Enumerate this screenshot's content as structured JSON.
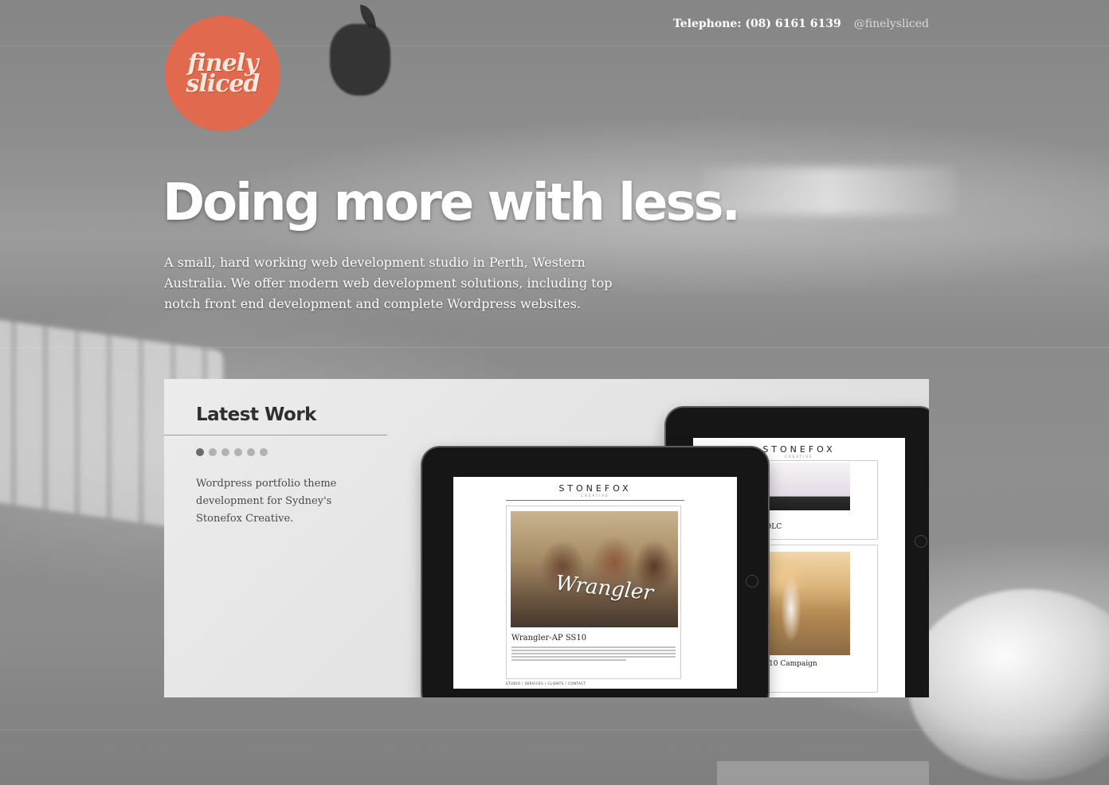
{
  "header": {
    "telephone": "Telephone: (08) 6161 6139",
    "twitter": "@finelysliced"
  },
  "logo": {
    "line1": "finely",
    "line2": "sliced"
  },
  "hero": {
    "title": "Doing more with less.",
    "description": "A small, hard working web development studio in Perth, Western Australia. We offer modern web development solutions, including top notch front end development and complete Wordpress websites."
  },
  "latest_work": {
    "title": "Latest Work",
    "slides_total": 6,
    "active_slide": 1,
    "description": "Wordpress portfolio theme development for Sydney's Stonefox Creative."
  },
  "showcase": {
    "brand": "STONEFOX",
    "brand_sub": "CREATIVE",
    "wrangler_script": "Wrangler",
    "front_post_title": "Wrangler-AP SS10",
    "back_post_title_1": "DLC",
    "back_post_title_2": "10 Campaign",
    "footer_nav": "STUDIO / SERVICES / CLIENTS / CONTACT"
  },
  "colors": {
    "logo_bg": "#e0694e",
    "logo_text": "#fbe8dc",
    "panel_bg": "#e6e6e6",
    "active_dot": "#6b6b6b",
    "inactive_dot": "#b2b2b2"
  }
}
